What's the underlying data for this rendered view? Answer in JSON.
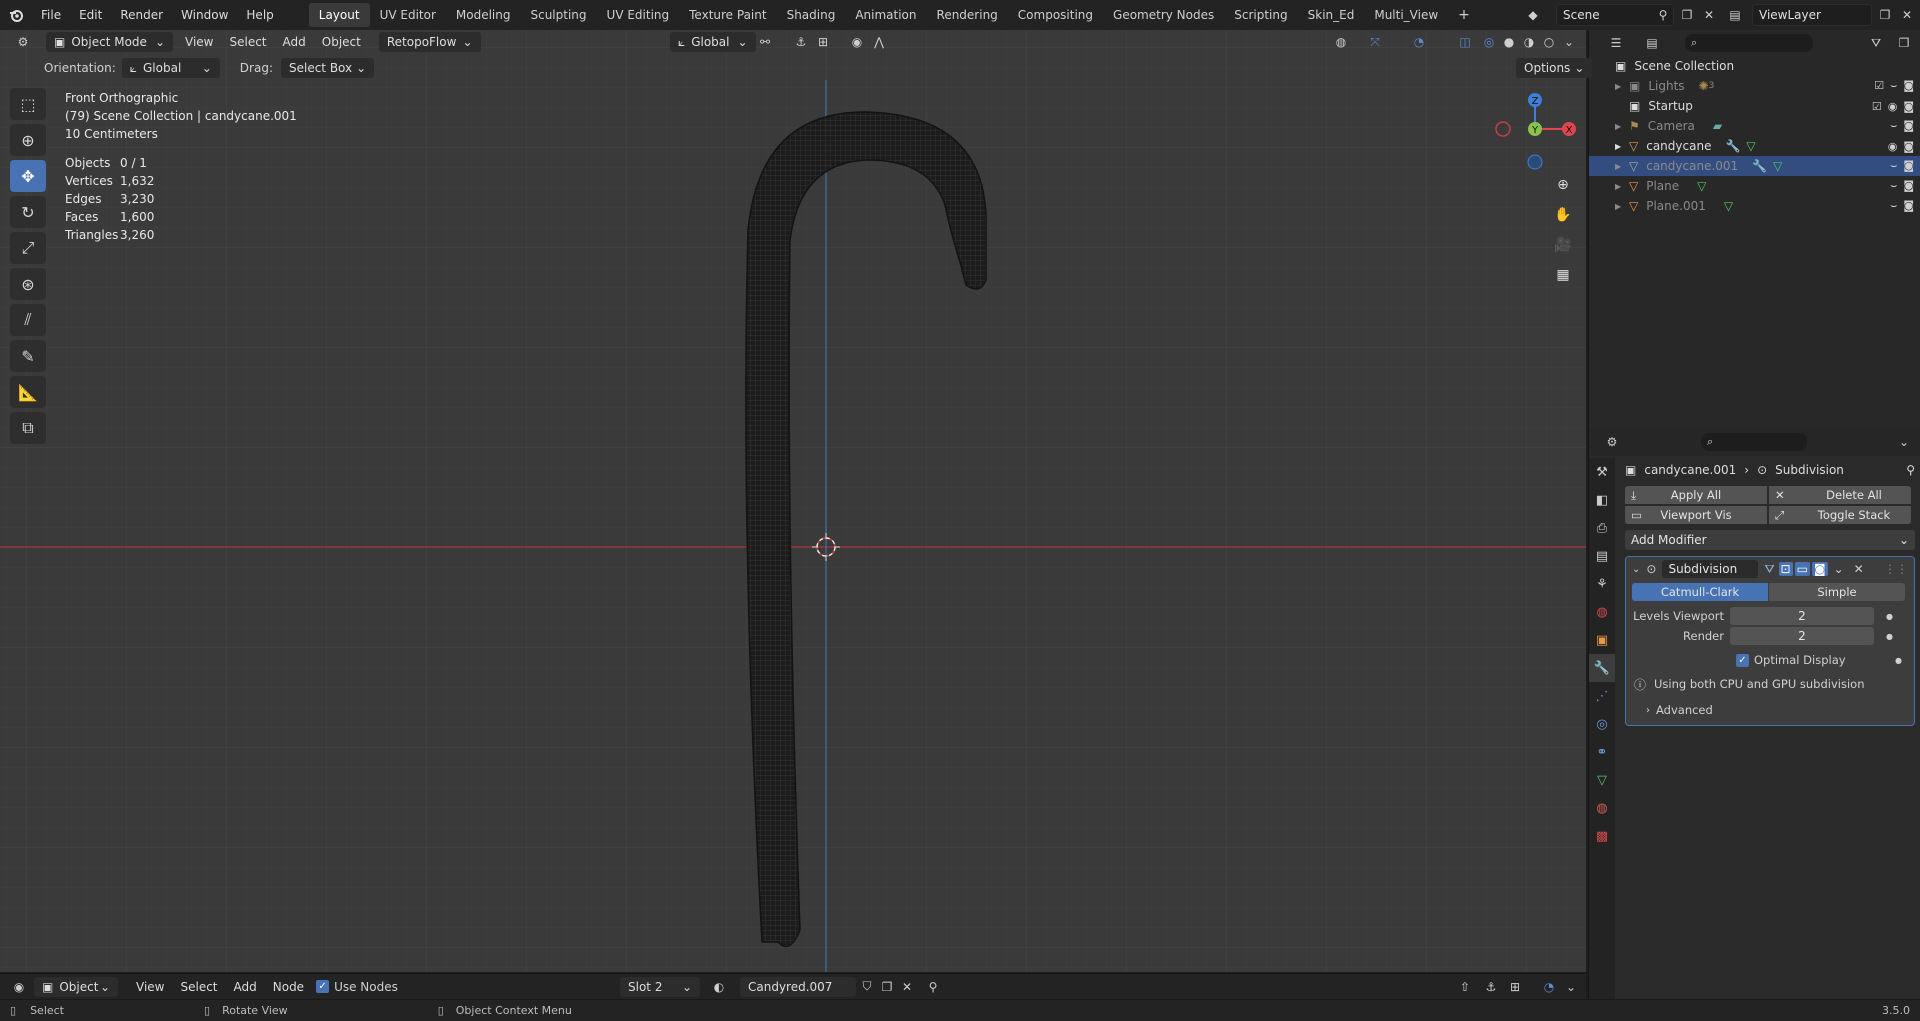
{
  "topbar": {
    "menus": [
      "File",
      "Edit",
      "Render",
      "Window",
      "Help"
    ],
    "workspaces": [
      "Layout",
      "UV Editor",
      "Modeling",
      "Sculpting",
      "UV Editing",
      "Texture Paint",
      "Shading",
      "Animation",
      "Rendering",
      "Compositing",
      "Geometry Nodes",
      "Scripting",
      "Skin_Ed",
      "Multi_View"
    ],
    "active_workspace": "Layout",
    "add_tab": "+",
    "scene": "Scene",
    "view_layer": "ViewLayer"
  },
  "viewport_header": {
    "mode": "Object Mode",
    "menus": [
      "View",
      "Select",
      "Add",
      "Object"
    ],
    "addon": "RetopoFlow",
    "transform": "Global"
  },
  "tool_settings": {
    "orientation_label": "Orientation:",
    "orientation_value": "Global",
    "drag_label": "Drag:",
    "drag_value": "Select Box",
    "options": "Options"
  },
  "overlay": {
    "view_name": "Front Orthographic",
    "collection": "(79) Scene Collection | candycane.001",
    "scale": "10 Centimeters",
    "stats": [
      {
        "k": "Objects",
        "v": "0 / 1"
      },
      {
        "k": "Vertices",
        "v": "1,632"
      },
      {
        "k": "Edges",
        "v": "3,230"
      },
      {
        "k": "Faces",
        "v": "1,600"
      },
      {
        "k": "Triangles",
        "v": "3,260"
      }
    ]
  },
  "gizmo": {
    "z": "Z",
    "y": "Y",
    "x": "X"
  },
  "colors": {
    "accent": "#4772b3",
    "x_axis": "#e0454f",
    "y_axis": "#8ac24a",
    "z_axis": "#3e7fd8",
    "selected_row": "#334d80"
  },
  "outliner": {
    "root": "Scene Collection",
    "items": [
      {
        "label": "Lights",
        "badge": "3",
        "dim": true,
        "selected": false
      },
      {
        "label": "Startup",
        "badge": "",
        "dim": false,
        "selected": false
      },
      {
        "label": "Camera",
        "badge": "",
        "dim": true,
        "selected": false
      },
      {
        "label": "candycane",
        "badge": "",
        "dim": false,
        "selected": false
      },
      {
        "label": "candycane.001",
        "badge": "",
        "dim": true,
        "selected": true
      },
      {
        "label": "Plane",
        "badge": "",
        "dim": true,
        "selected": false
      },
      {
        "label": "Plane.001",
        "badge": "",
        "dim": true,
        "selected": false
      }
    ]
  },
  "properties": {
    "breadcrumb_object": "candycane.001",
    "breadcrumb_modifier": "Subdivision",
    "apply_all": "Apply All",
    "delete_all": "Delete All",
    "viewport_vis": "Viewport Vis",
    "toggle_stack": "Toggle Stack",
    "add_modifier": "Add Modifier",
    "modifier_name": "Subdivision",
    "catmull": "Catmull-Clark",
    "simple": "Simple",
    "levels_label": "Levels Viewport",
    "levels_value": "2",
    "render_label": "Render",
    "render_value": "2",
    "optimal": "Optimal Display",
    "info": "Using both CPU and GPU subdivision",
    "advanced": "Advanced"
  },
  "bottom_header": {
    "mode": "Object",
    "menus": [
      "View",
      "Select",
      "Add",
      "Node"
    ],
    "use_nodes": "Use Nodes",
    "slot": "Slot 2",
    "material": "Candyred.007"
  },
  "statusbar": {
    "select": "Select",
    "rotate": "Rotate View",
    "context": "Object Context Menu",
    "version": "3.5.0"
  }
}
